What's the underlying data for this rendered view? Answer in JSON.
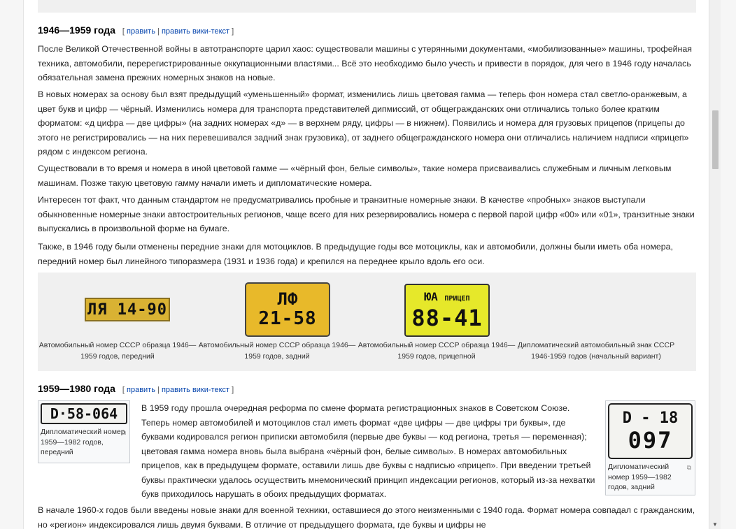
{
  "sections": [
    {
      "title": "1946—1959 года",
      "edit_open": "[",
      "edit_link": "править",
      "edit_sep": "|",
      "edit_link2": "править вики-текст",
      "edit_close": "]"
    },
    {
      "title": "1959—1980 года",
      "edit_open": "[",
      "edit_link": "править",
      "edit_sep": "|",
      "edit_link2": "править вики-текст",
      "edit_close": "]"
    }
  ],
  "paragraphs": [
    "После Великой Отечественной войны в автотранспорте царил хаос: существовали машины с утерянными документами, «мобилизованные» машины, трофейная техника, автомобили, перерегистрированные оккупационными властями... Всё это необходимо было учесть и привести в порядок, для чего в 1946 году началась обязательная замена прежних номерных знаков на новые.",
    "В новых номерах за основу был взят предыдущий «уменьшенный» формат, изменились лишь цветовая гамма — теперь фон номера стал светло-оранжевым, а цвет букв и цифр — чёрный. Изменились номера для транспорта представителей дипмиссий, от общегражданских они отличались только более кратким форматом: «д цифра — две цифры» (на задних номерах «д» — в верхнем ряду, цифры — в нижнем). Появились и номера для грузовых прицепов (прицепы до этого не регистрировались — на них перевешивался задний знак грузовика), от заднего общегражданского номера они отличались наличием надписи «прицеп» рядом с индексом региона.",
    "Существовали в то время и номера в иной цветовой гамме — «чёрный фон, белые символы», такие номера присваивались служебным и личным легковым машинам. Позже такую цветовую гамму начали иметь и дипломатические номера.",
    "Интересен тот факт, что данным стандартом не предусматривались пробные и транзитные номерные знаки. В качестве «пробных» знаков выступали обыкновенные номерные знаки автостроительных регионов, чаще всего для них резервировались номера с первой парой цифр «00» или «01», транзитные знаки выпускались в произвольной форме на бумаге.",
    "Также, в 1946 году были отменены передние знаки для мотоциклов. В предыдущие годы все мотоциклы, как и автомобили, должны были иметь оба номера, передний номер был линейного типоразмера (1931 и 1936 года) и крепился на переднее крыло вдоль его оси.",
    "В 1959 году прошла очередная реформа по смене формата регистрационных знаков в Советском Союзе. Теперь номер автомобилей и мотоциклов стал иметь формат «две цифры — две цифры три буквы», где буквами кодировался регион приписки автомобиля (первые две буквы — код региона, третья — переменная); цветовая гамма номера вновь была выбрана «чёрный фон, белые символы». В номерах автомобильных прицепов, как в предыдущем формате, оставили лишь две буквы с надписью «прицеп». При введении третьей буквы практически удалось осуществить мнемонический принцип индексации регионов, который из-за нехватки букв приходилось нарушать в обоих предыдущих форматах.",
    "В начале 1960-х годов были введены новые знаки для военной техники, оставшиеся до этого неизменными с 1940 года. Формат номера совпадал с гражданским, но «регион» индексировался лишь двумя буквами. В отличие от предыдущего формата, где буквы и цифры не"
  ],
  "gallery": [
    {
      "plate": "ЛЯ 14-90",
      "caption": "Автомобильный номер СССР образца 1946—1959 годов, передний"
    },
    {
      "plate_top": "ЛФ",
      "plate_bottom": "21-58",
      "caption": "Автомобильный номер СССР образца 1946—1959 годов, задний"
    },
    {
      "plate_top": "ЮА",
      "plate_tag": "ПРИЦЕП",
      "plate_bottom": "88-41",
      "caption": "Автомобильный номер СССР образца 1946—1959 годов, прицепной"
    },
    {
      "caption": "Дипломатический автомобильный знак СССР 1946-1959 годов (начальный вариант)"
    }
  ],
  "thumbs": [
    {
      "plate": "D·58-064",
      "caption": "Дипломатический номер 1959—1982 годов, передний"
    },
    {
      "plate_top": "D - 18",
      "plate_bottom": "097",
      "caption": "Дипломатический номер 1959—1982 годов, задний"
    }
  ],
  "colors": {
    "link": "#0645ad",
    "plate_yellow": "#e8b92a",
    "plate_lime": "#e6e82a",
    "plate_white": "#f3f3f0"
  },
  "icons": {
    "magnify": "magnify-icon"
  }
}
